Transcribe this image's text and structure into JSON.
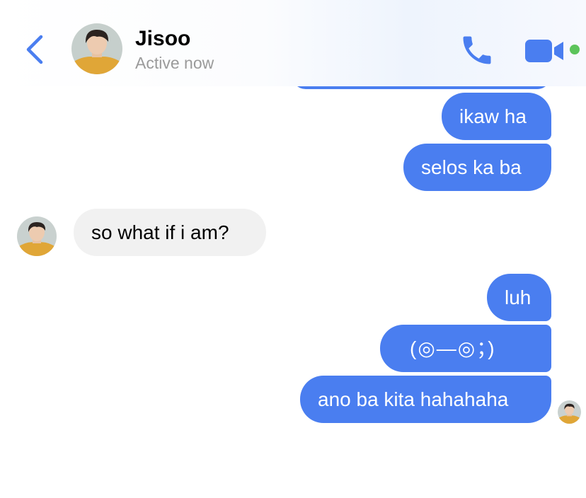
{
  "header": {
    "back_icon": "chevron-left-icon",
    "contact_name": "Jisoo",
    "status": "Active now",
    "call_icon": "phone-icon",
    "video_icon": "video-camera-icon",
    "accent": "#4a7ef0",
    "active_color": "#5cc45b"
  },
  "messages": [
    {
      "from": "me",
      "text": "ikaw ha"
    },
    {
      "from": "me",
      "text": "selos ka ba"
    },
    {
      "from": "them",
      "text": "so what if i am?"
    },
    {
      "from": "me",
      "text": "luh"
    },
    {
      "from": "me",
      "text": "(◎—◎；)"
    },
    {
      "from": "me",
      "text": "ano ba kita hahahaha"
    }
  ],
  "colors": {
    "outgoing_bubble": "#4a7ef0",
    "incoming_bubble": "#f1f1f1"
  }
}
